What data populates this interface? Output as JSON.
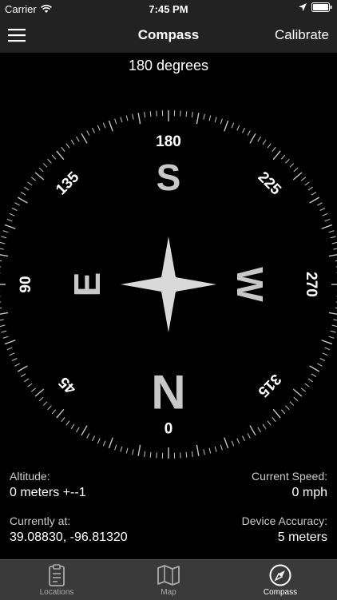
{
  "status_bar": {
    "carrier": "Carrier",
    "time": "7:45 PM"
  },
  "nav": {
    "title": "Compass",
    "calibrate_label": "Calibrate"
  },
  "heading": {
    "text": "180 degrees"
  },
  "compass": {
    "heading_degrees": 180,
    "tick_labels": [
      "0",
      "45",
      "90",
      "135",
      "180",
      "225",
      "270",
      "315"
    ],
    "cardinals": {
      "north": "N",
      "east": "E",
      "south": "S",
      "west": "W"
    },
    "colors": {
      "ring": "#c8c8c8",
      "letters": "#c8c8c8",
      "star": "#d9d9d9"
    }
  },
  "info": {
    "altitude_label": "Altitude:",
    "altitude_value": "0 meters +--1",
    "speed_label": "Current Speed:",
    "speed_value": "0 mph",
    "location_label": "Currently at:",
    "location_value": "39.08830, -96.81320",
    "accuracy_label": "Device Accuracy:",
    "accuracy_value": "5 meters"
  },
  "tabs": [
    {
      "label": "Locations",
      "icon": "clipboard-icon",
      "active": false
    },
    {
      "label": "Map",
      "icon": "map-icon",
      "active": false
    },
    {
      "label": "Compass",
      "icon": "compass-icon",
      "active": true
    }
  ]
}
